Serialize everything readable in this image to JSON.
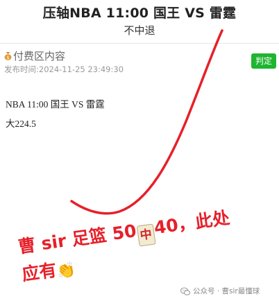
{
  "header": {
    "title": "压轴NBA 11:00 国王 VS 雷霆",
    "subtitle": "不中退"
  },
  "post": {
    "paid_label": "付费区内容",
    "publish_time": "发布时间:2024-11-25 23:49:30",
    "judge_button": "判定",
    "line1": "NBA 11:00 国王 VS 雷霆",
    "line2": "大224.5"
  },
  "overlay": {
    "part1": "曹 sir 足篮 50",
    "tile_char": "中",
    "part2": "40，此处",
    "part3": "应有"
  },
  "watermark": {
    "text": "公众号 · 曹sir最懂球"
  },
  "colors": {
    "accent_green": "#1fb531",
    "overlay_red": "#e6202a"
  },
  "icons": {
    "paid": "money-bag-icon",
    "clap": "clapping-hands-icon",
    "watermark": "wechat-icon"
  }
}
